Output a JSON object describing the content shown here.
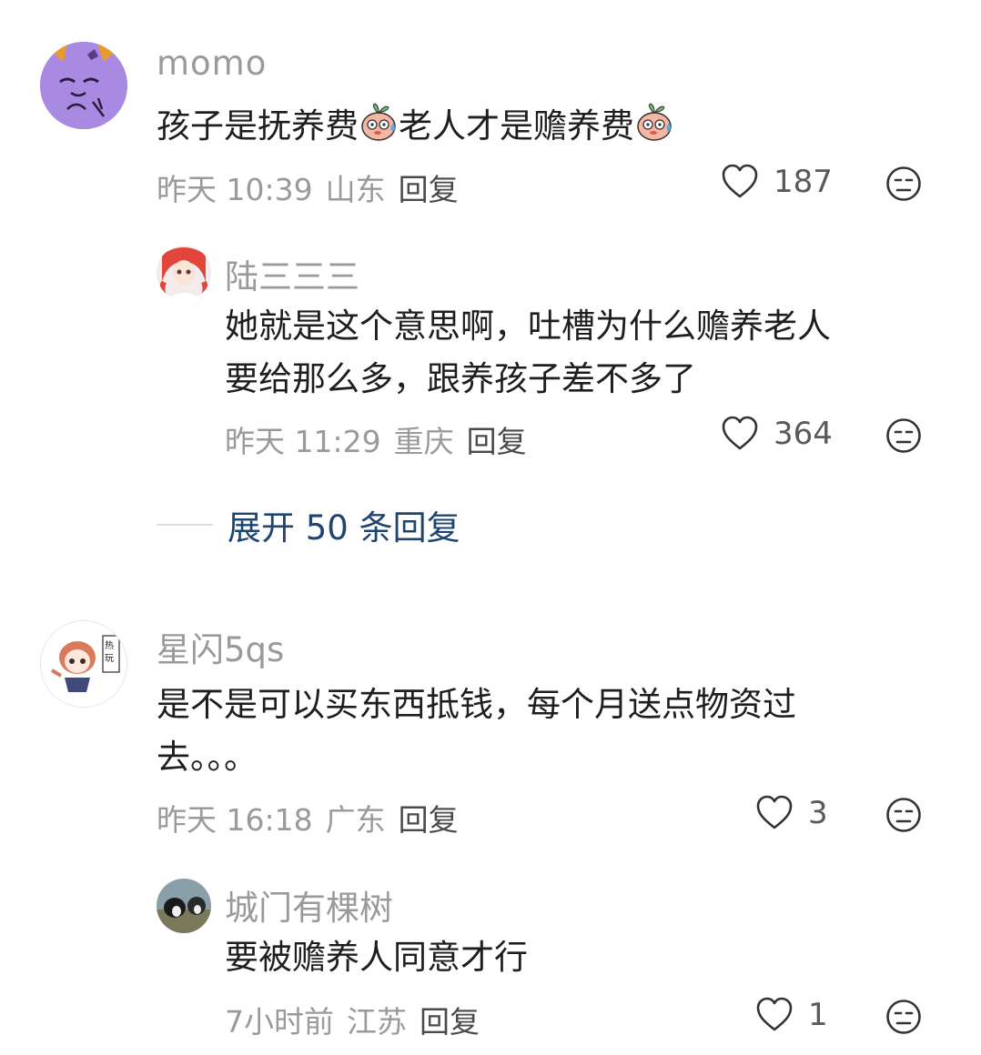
{
  "comments": [
    {
      "username": "momo",
      "text_parts": [
        "孩子是抚养费",
        "老人才是赡养费"
      ],
      "emoji": "sweating-peach-emoji",
      "time": "昨天 10:39",
      "location": "山东",
      "reply_label": "回复",
      "likes": "187",
      "avatar_color": "#a78be0"
    },
    {
      "username": "陆三三三",
      "text_lines": [
        "她就是这个意思啊，吐槽为什么赡养老人",
        "要给那么多，跟养孩子差不多了"
      ],
      "time": "昨天 11:29",
      "location": "重庆",
      "reply_label": "回复",
      "likes": "364"
    },
    {
      "username": "星闪5qs",
      "text_lines": [
        "是不是可以买东西抵钱，每个月送点物资过",
        "去。。。"
      ],
      "time": "昨天 16:18",
      "location": "广东",
      "reply_label": "回复",
      "likes": "3"
    },
    {
      "username": "城门有棵树",
      "text_lines": [
        "要被赡养人同意才行"
      ],
      "time": "7小时前",
      "location": "江苏",
      "reply_label": "回复",
      "likes": "1"
    }
  ],
  "expand_replies": "展开 50 条回复",
  "icons": {
    "like": "heart-outline-icon",
    "dislike": "unamused-face-icon"
  },
  "colors": {
    "link_blue": "#1f4470",
    "meta_gray": "#9a9a9a"
  }
}
